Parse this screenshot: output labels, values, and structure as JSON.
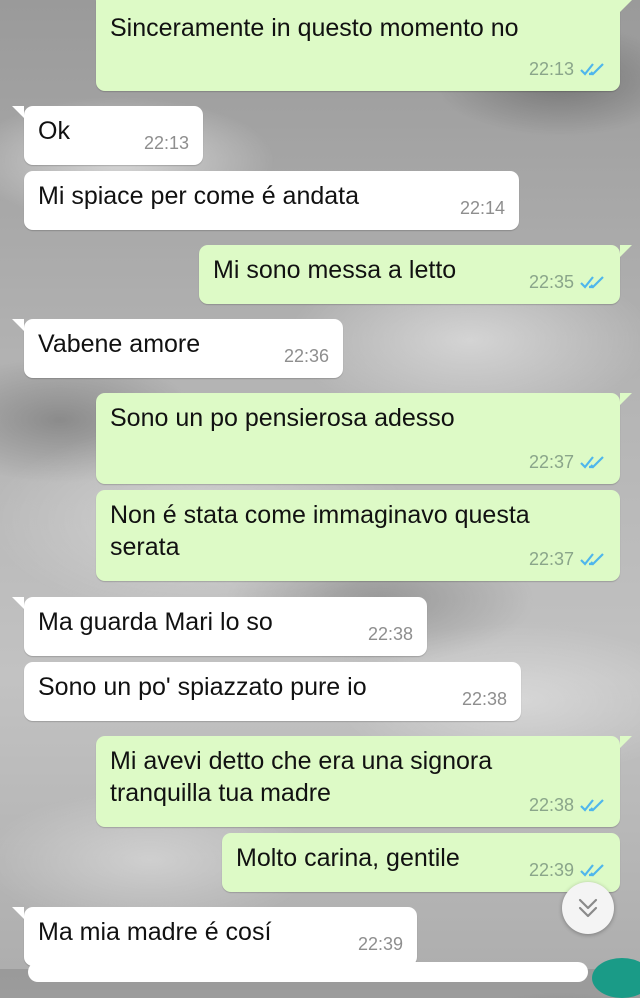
{
  "messages": [
    {
      "side": "out",
      "text": "Sinceramente in questo momento no",
      "time": "22:13",
      "read": true
    },
    {
      "side": "in",
      "text": "Ok",
      "time": "22:13"
    },
    {
      "side": "in",
      "text": "Mi spiace per come é andata",
      "time": "22:14"
    },
    {
      "side": "out",
      "text": "Mi sono messa a letto",
      "time": "22:35",
      "read": true
    },
    {
      "side": "in",
      "text": "Vabene amore",
      "time": "22:36"
    },
    {
      "side": "out",
      "text": "Sono un po pensierosa adesso",
      "time": "22:37",
      "read": true
    },
    {
      "side": "out",
      "text": "Non é stata come immaginavo questa serata",
      "time": "22:37",
      "read": true
    },
    {
      "side": "in",
      "text": "Ma guarda Mari lo so",
      "time": "22:38"
    },
    {
      "side": "in",
      "text": "Sono un po' spiazzato pure io",
      "time": "22:38"
    },
    {
      "side": "out",
      "text": "Mi avevi detto che era una signora tranquilla tua madre",
      "time": "22:38",
      "read": true
    },
    {
      "side": "out",
      "text": "Molto carina, gentile",
      "time": "22:39",
      "read": true
    },
    {
      "side": "in",
      "text": "Ma mia madre é cosí",
      "time": "22:39"
    }
  ],
  "colors": {
    "incoming_bubble": "#ffffff",
    "outgoing_bubble": "#ddfac6",
    "read_ticks": "#4fb6ec",
    "fab": "#1a9b87"
  },
  "icons": {
    "read_receipt": "double-check-icon",
    "scroll_down": "chevron-double-down-icon"
  }
}
